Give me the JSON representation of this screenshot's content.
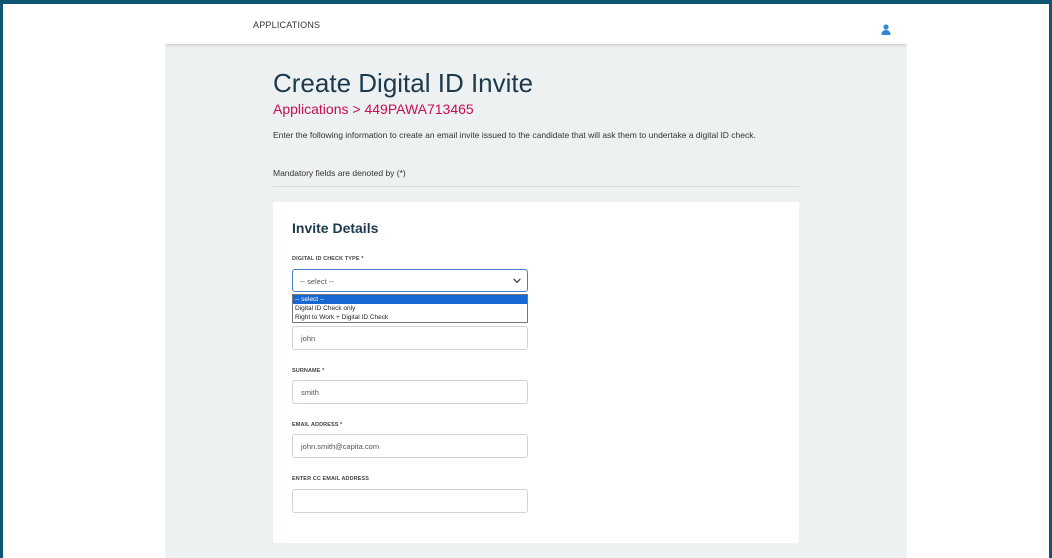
{
  "header": {
    "nav_label": "APPLICATIONS",
    "user_icon": "user-icon"
  },
  "page": {
    "title": "Create Digital ID Invite",
    "breadcrumb_link": "Applications",
    "breadcrumb_separator": " > ",
    "breadcrumb_current": "449PAWA713465",
    "intro": "Enter the following information to create an email invite issued to the candidate that will ask them to undertake a digital ID check.",
    "mandatory_note": "Mandatory fields are denoted by (*)"
  },
  "form": {
    "title": "Invite Details",
    "check_type": {
      "label": "DIGITAL ID CHECK TYPE *",
      "value": "-- select --",
      "options": [
        "-- select --",
        "Digital ID Check only",
        "Right to Work + Digital ID Check"
      ],
      "selected_index": 0
    },
    "first_name": {
      "value": "john"
    },
    "surname": {
      "label": "SURNAME *",
      "value": "smith"
    },
    "email": {
      "label": "EMAIL ADDRESS *",
      "value": "john.smith@capita.com"
    },
    "cc_email": {
      "label": "ENTER CC EMAIL ADDRESS",
      "value": ""
    }
  },
  "colors": {
    "frame": "#0d5571",
    "title": "#1c3a4e",
    "breadcrumb": "#c8104e",
    "selected_option": "#1967d2",
    "user_icon": "#2a8ad6"
  }
}
